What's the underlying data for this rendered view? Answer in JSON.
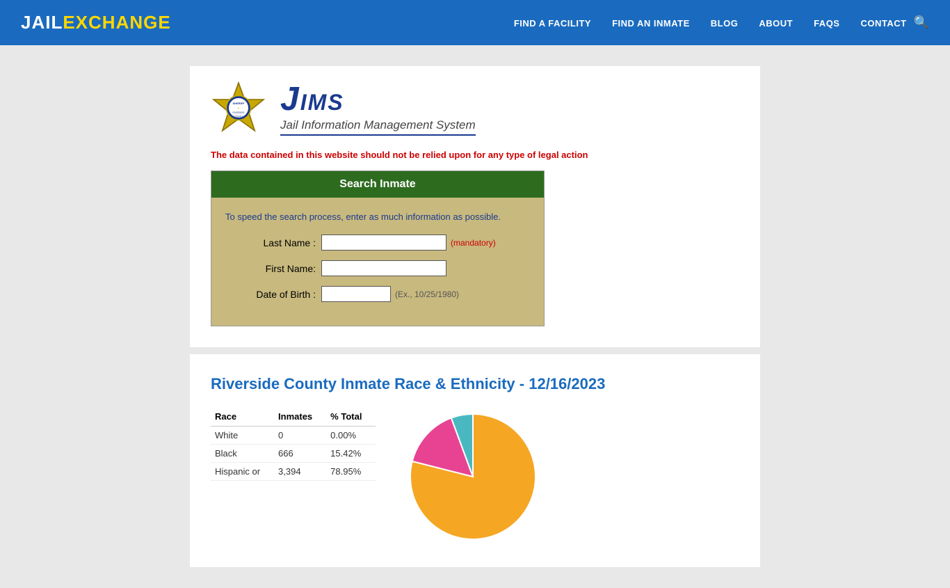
{
  "brand": {
    "name_part1": "JAIL",
    "name_part2": "EXCHANGE"
  },
  "nav": {
    "links": [
      {
        "id": "find-facility",
        "label": "FIND A FACILITY"
      },
      {
        "id": "find-inmate",
        "label": "FIND AN INMATE"
      },
      {
        "id": "blog",
        "label": "BLOG"
      },
      {
        "id": "about",
        "label": "ABOUT"
      },
      {
        "id": "faqs",
        "label": "FAQs"
      },
      {
        "id": "contact",
        "label": "CONTACT"
      }
    ]
  },
  "jims": {
    "title": "JIMS",
    "subtitle": "Jail Information Management System"
  },
  "disclaimer": "The data contained in this website should not be relied upon for any type of legal action",
  "search": {
    "title": "Search Inmate",
    "hint": "To speed the search process, enter as much information as possible.",
    "last_name_label": "Last Name :",
    "last_name_mandatory": "(mandatory)",
    "first_name_label": "First Name:",
    "dob_label": "Date of Birth :",
    "dob_example": "(Ex., 10/25/1980)"
  },
  "stats": {
    "title": "Riverside County Inmate Race & Ethnicity - 12/16/2023",
    "columns": [
      "Race",
      "Inmates",
      "% Total"
    ],
    "rows": [
      {
        "race": "White",
        "inmates": "0",
        "pct": "0.00%"
      },
      {
        "race": "Black",
        "inmates": "666",
        "pct": "15.42%"
      },
      {
        "race": "Hispanic or",
        "inmates": "3,394",
        "pct": "78.95%"
      }
    ]
  },
  "chart": {
    "segments": [
      {
        "label": "Hispanic",
        "color": "#f5a623",
        "pct": 78.95
      },
      {
        "label": "Black",
        "color": "#e84393",
        "pct": 15.42
      },
      {
        "label": "White",
        "color": "#4ab8c1",
        "pct": 5.63
      }
    ]
  }
}
